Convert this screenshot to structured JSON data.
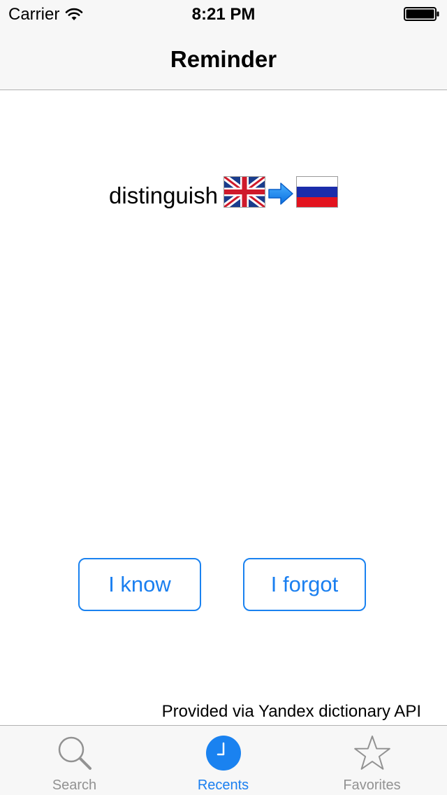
{
  "status_bar": {
    "carrier": "Carrier",
    "time": "8:21 PM",
    "icons": [
      "wifi-icon",
      "battery-icon"
    ]
  },
  "nav": {
    "title": "Reminder"
  },
  "card": {
    "word": "distinguish",
    "source_flag": "uk-flag-icon",
    "arrow": "arrow-right-icon",
    "target_flag": "russia-flag-icon"
  },
  "actions": {
    "know_label": "I know",
    "forgot_label": "I forgot"
  },
  "footer": {
    "attribution": "Provided via Yandex dictionary API"
  },
  "tabs": [
    {
      "label": "Search",
      "icon": "search-icon",
      "selected": false
    },
    {
      "label": "Recents",
      "icon": "clock-icon",
      "selected": true
    },
    {
      "label": "Favorites",
      "icon": "star-icon",
      "selected": false
    }
  ],
  "colors": {
    "accent": "#1a7ff0",
    "inactive_tab": "#929292",
    "bar_background": "#f7f7f7"
  }
}
